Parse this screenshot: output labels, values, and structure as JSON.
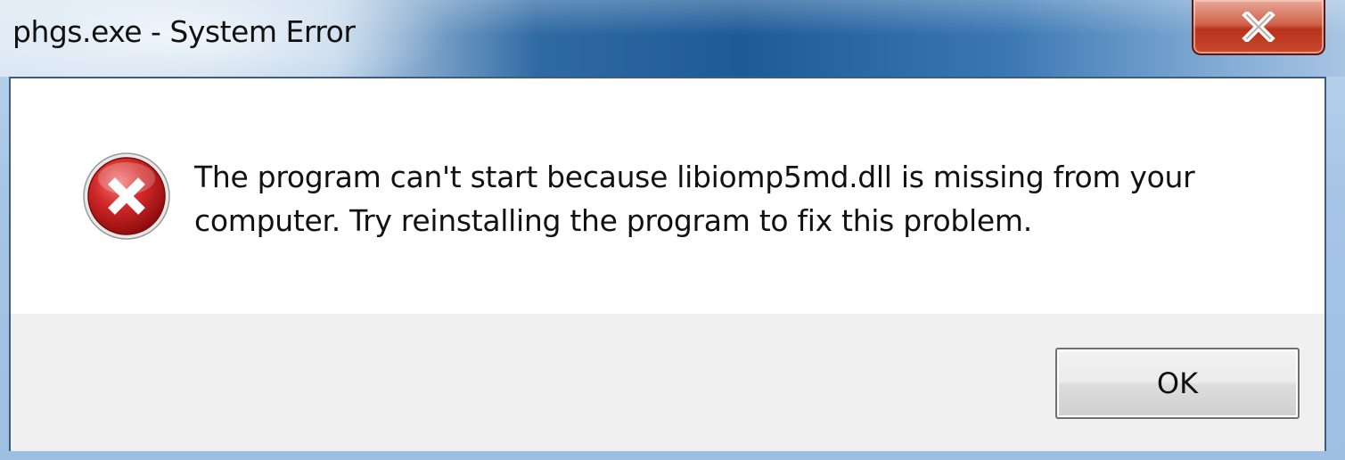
{
  "window": {
    "title": "phgs.exe - System Error",
    "close_symbol": "X",
    "close_icon": "close-icon"
  },
  "dialog": {
    "icon": "error-icon",
    "message": "The program can't start because libiomp5md.dll is missing from your computer. Try reinstalling the program to fix this problem.",
    "ok_label": "OK"
  },
  "colors": {
    "titlebar_accent": "#1e5a97",
    "close_button": "#c94a2e",
    "error_icon": "#c8161d",
    "footer_bg": "#f0f0f0"
  }
}
